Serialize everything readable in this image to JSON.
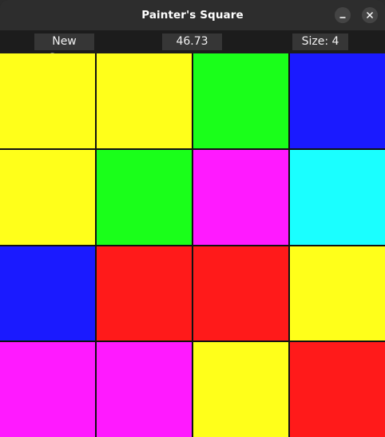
{
  "window": {
    "title": "Painter's Square"
  },
  "toolbar": {
    "new_game_label": "New Game",
    "timer": "46.73",
    "size_label": "Size: 4"
  },
  "board": {
    "size": 4,
    "grid": [
      [
        "yellow",
        "yellow",
        "green",
        "blue"
      ],
      [
        "yellow",
        "green",
        "magenta",
        "cyan"
      ],
      [
        "blue",
        "red",
        "red",
        "yellow"
      ],
      [
        "magenta",
        "magenta",
        "yellow",
        "red"
      ]
    ]
  },
  "colors": {
    "yellow": "#ffff1a",
    "green": "#1aff1a",
    "blue": "#1a1aff",
    "magenta": "#ff1aff",
    "cyan": "#1affff",
    "red": "#ff1a1a"
  }
}
